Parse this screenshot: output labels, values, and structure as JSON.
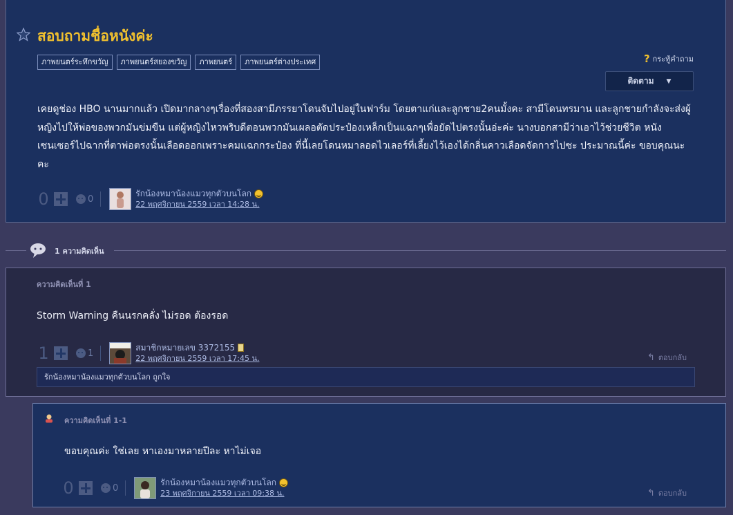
{
  "topic": {
    "title": "สอบถามชื่อหนังค่ะ",
    "tags": [
      "ภาพยนตร์ระทึกขวัญ",
      "ภาพยนตร์สยองขวัญ",
      "ภาพยนตร์",
      "ภาพยนตร์ต่างประเทศ"
    ],
    "question_type_label": "กระทู้คำถาม",
    "follow_label": "ติดตาม",
    "body": "เคยดูช่อง HBO นานมากแล้ว เปิดมากลางๆเรื่องที่สองสามีภรรยาโดนจับไปอยู่ในฟาร์ม โดยตาแก่และลูกชาย2คนมั้งคะ สามีโดนทรมาน และลูกชายกำลังจะส่งผู้หญิงไปให้พ่อของพวกมันข่มขืน แต่ผู้หญิงไหวพริบดีตอนพวกมันเผลอตัดประป๋องเหล็กเป็นแฉกๆเพื่อยัดไปตรงนั้นอ่ะค่ะ นางบอกสามีว่าเอาไว้ช่วยชีวิต หนังเซนเซอร์ไปฉากที่ตาพ่อตรงนั้นเลือดออกเพราะคมแฉกกระป๋อง ที่นี้เลยโดนหมาลอดไวเลอร์ที่เลี้ยงไว้เองได้กลิ่นคาวเลือดจัดการไปซะ ประมาณนี้ค่ะ ขอบคุณนะคะ",
    "votes": "0",
    "emotions": "0",
    "author": "รักน้องหมาน้องแมวทุกตัวบนโลก",
    "time": "22 พฤศจิกายน 2559 เวลา 14:28 น."
  },
  "comments_header": "1 ความคิดเห็น",
  "comments": [
    {
      "label": "ความคิดเห็นที่ 1",
      "text": "Storm Warning คืนนรกคลั่ง ไม่รอด ต้องรอด",
      "votes": "1",
      "emotions": "1",
      "author": "สมาชิกหมายเลข 3372155",
      "time": "22 พฤศจิกายน 2559 เวลา 17:45 น.",
      "reply_label": "ตอบกลับ",
      "likes_text": "รักน้องหมาน้องแมวทุกตัวบนโลก ถูกใจ"
    }
  ],
  "replies": [
    {
      "label": "ความคิดเห็นที่ 1-1",
      "text": "ขอบคุณค่ะ ใช่เลย หาเองมาหลายปีละ หาไม่เจอ",
      "votes": "0",
      "emotions": "0",
      "author": "รักน้องหมาน้องแมวทุกตัวบนโลก",
      "time": "23 พฤศจิกายน 2559 เวลา 09:38 น.",
      "reply_label": "ตอบกลับ"
    }
  ],
  "colors": {
    "title": "#f2c12e",
    "topic_bg": "#1b305f",
    "page_bg": "#3a3a5e",
    "comment_bg": "#272945"
  },
  "icons": {
    "star": "star-icon",
    "question": "question-icon",
    "comment": "comment-bubble-icon",
    "reply": "reply-arrow-icon",
    "emotion": "emotion-icon",
    "plus": "plus-icon"
  }
}
